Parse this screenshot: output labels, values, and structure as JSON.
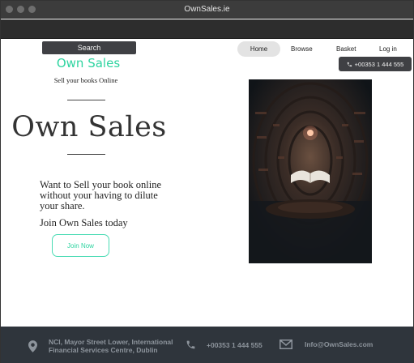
{
  "window": {
    "title": "OwnSales.ie"
  },
  "header": {
    "search_label": "Search",
    "brand": "Own Sales",
    "tagline": "Sell your books Online"
  },
  "nav": {
    "items": [
      "Home",
      "Browse",
      "Basket",
      "Log in"
    ],
    "active": "Home",
    "phone": "+00353 1 444 555"
  },
  "hero": {
    "title": "Own Sales",
    "pitch": "Want to Sell your book online without your having to dilute your share.",
    "join_text": "Join Own Sales today",
    "join_button": "Join Now"
  },
  "footer": {
    "address": "NCI, Mayor Street Lower, International Financial Services Centre, Dublin",
    "phone": "+00353 1 444 555",
    "email": "Info@OwnSales.com"
  },
  "colors": {
    "accent": "#2ed4a0",
    "dark_button": "#3f4044",
    "footer_bg": "#2f353c"
  },
  "icons": {
    "footer_location": "map-pin-icon",
    "footer_phone": "phone-icon",
    "footer_email": "envelope-icon",
    "nav_phone": "phone-icon"
  }
}
